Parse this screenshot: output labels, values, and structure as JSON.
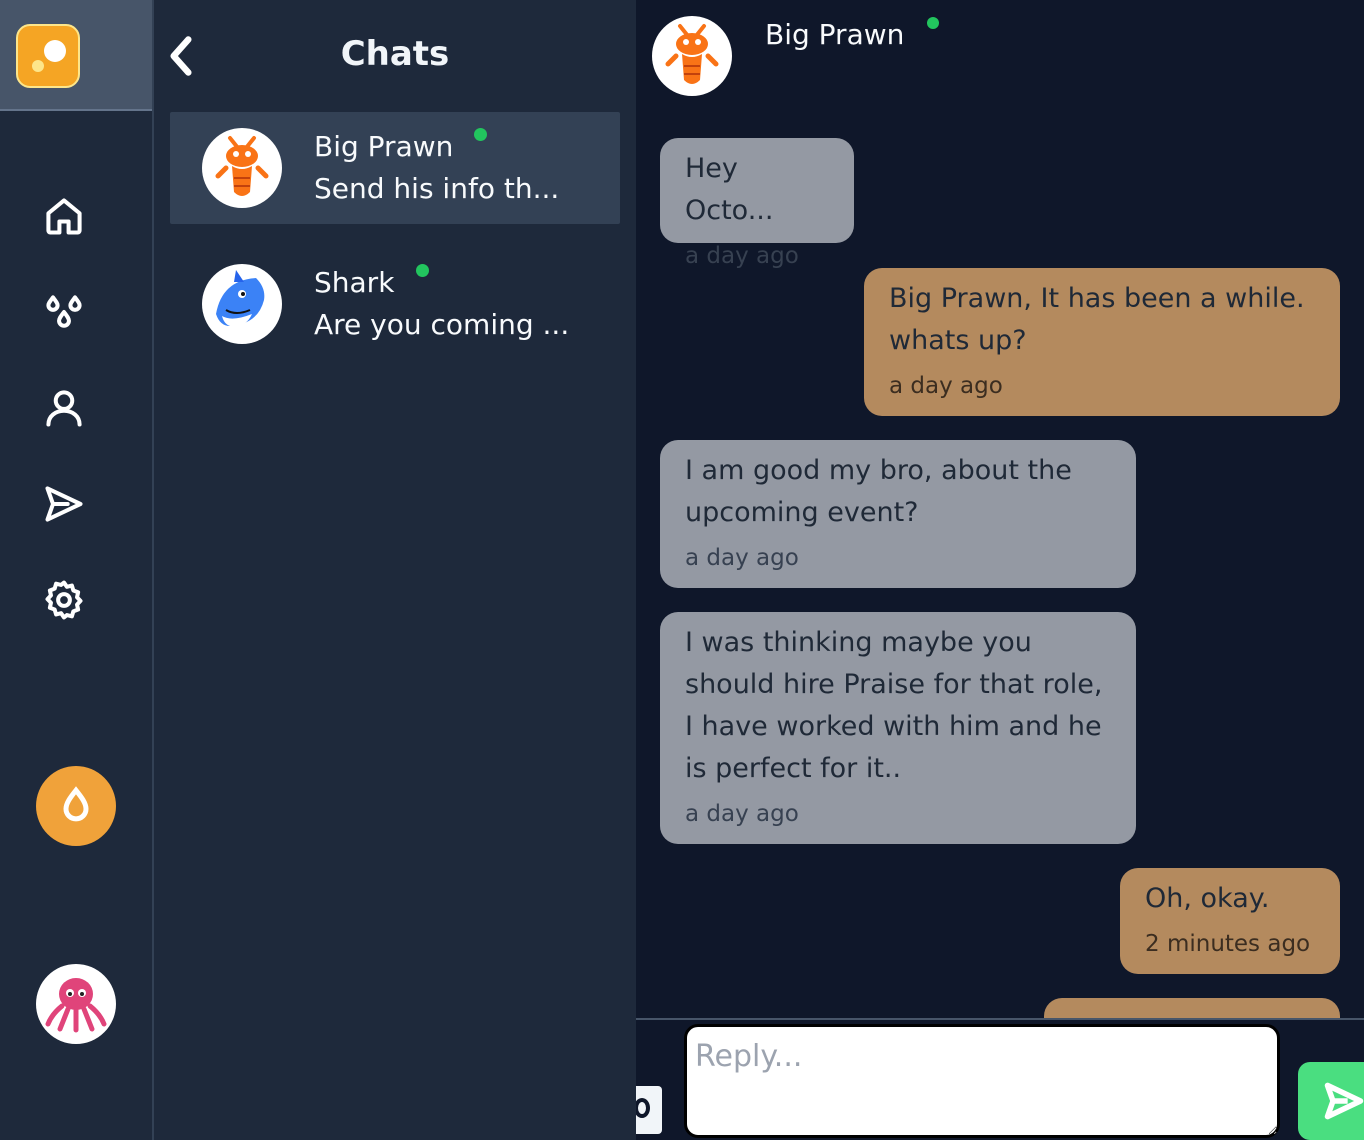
{
  "chat_list": {
    "title": "Chats",
    "items": [
      {
        "name": "Big Prawn",
        "preview": "Send his info th...",
        "online": true,
        "active": true,
        "avatar": "prawn-avatar"
      },
      {
        "name": "Shark",
        "preview": "Are you coming ...",
        "online": true,
        "active": false,
        "avatar": "shark-avatar"
      }
    ]
  },
  "conversation": {
    "contact_name": "Big Prawn",
    "contact_online": true,
    "messages": [
      {
        "direction": "in",
        "text": "Hey Octo...",
        "time": "a day ago"
      },
      {
        "direction": "out",
        "text": "Big Prawn, It has been a while. whats up?",
        "time": "a day ago"
      },
      {
        "direction": "in",
        "text": "I am good my bro, about the upcoming event?",
        "time": "a day ago"
      },
      {
        "direction": "in",
        "text": "I was thinking maybe you should hire Praise for that role, I have worked with him and he is perfect for it..",
        "time": "a day ago"
      },
      {
        "direction": "out",
        "text": "Oh, okay.",
        "time": "2 minutes ago"
      }
    ]
  },
  "composer": {
    "placeholder": "Reply..."
  },
  "sidebar": {
    "icons": [
      "home-icon",
      "drops-icon",
      "user-icon",
      "send-nav-icon",
      "settings-icon"
    ]
  },
  "colors": {
    "rail_bg": "#1e293b",
    "incoming_bubble": "#9499a3",
    "outgoing_bubble": "#b48a5e",
    "online_dot": "#22c55e",
    "accent_orange": "#f0a23a",
    "send_button": "#4ade80"
  }
}
